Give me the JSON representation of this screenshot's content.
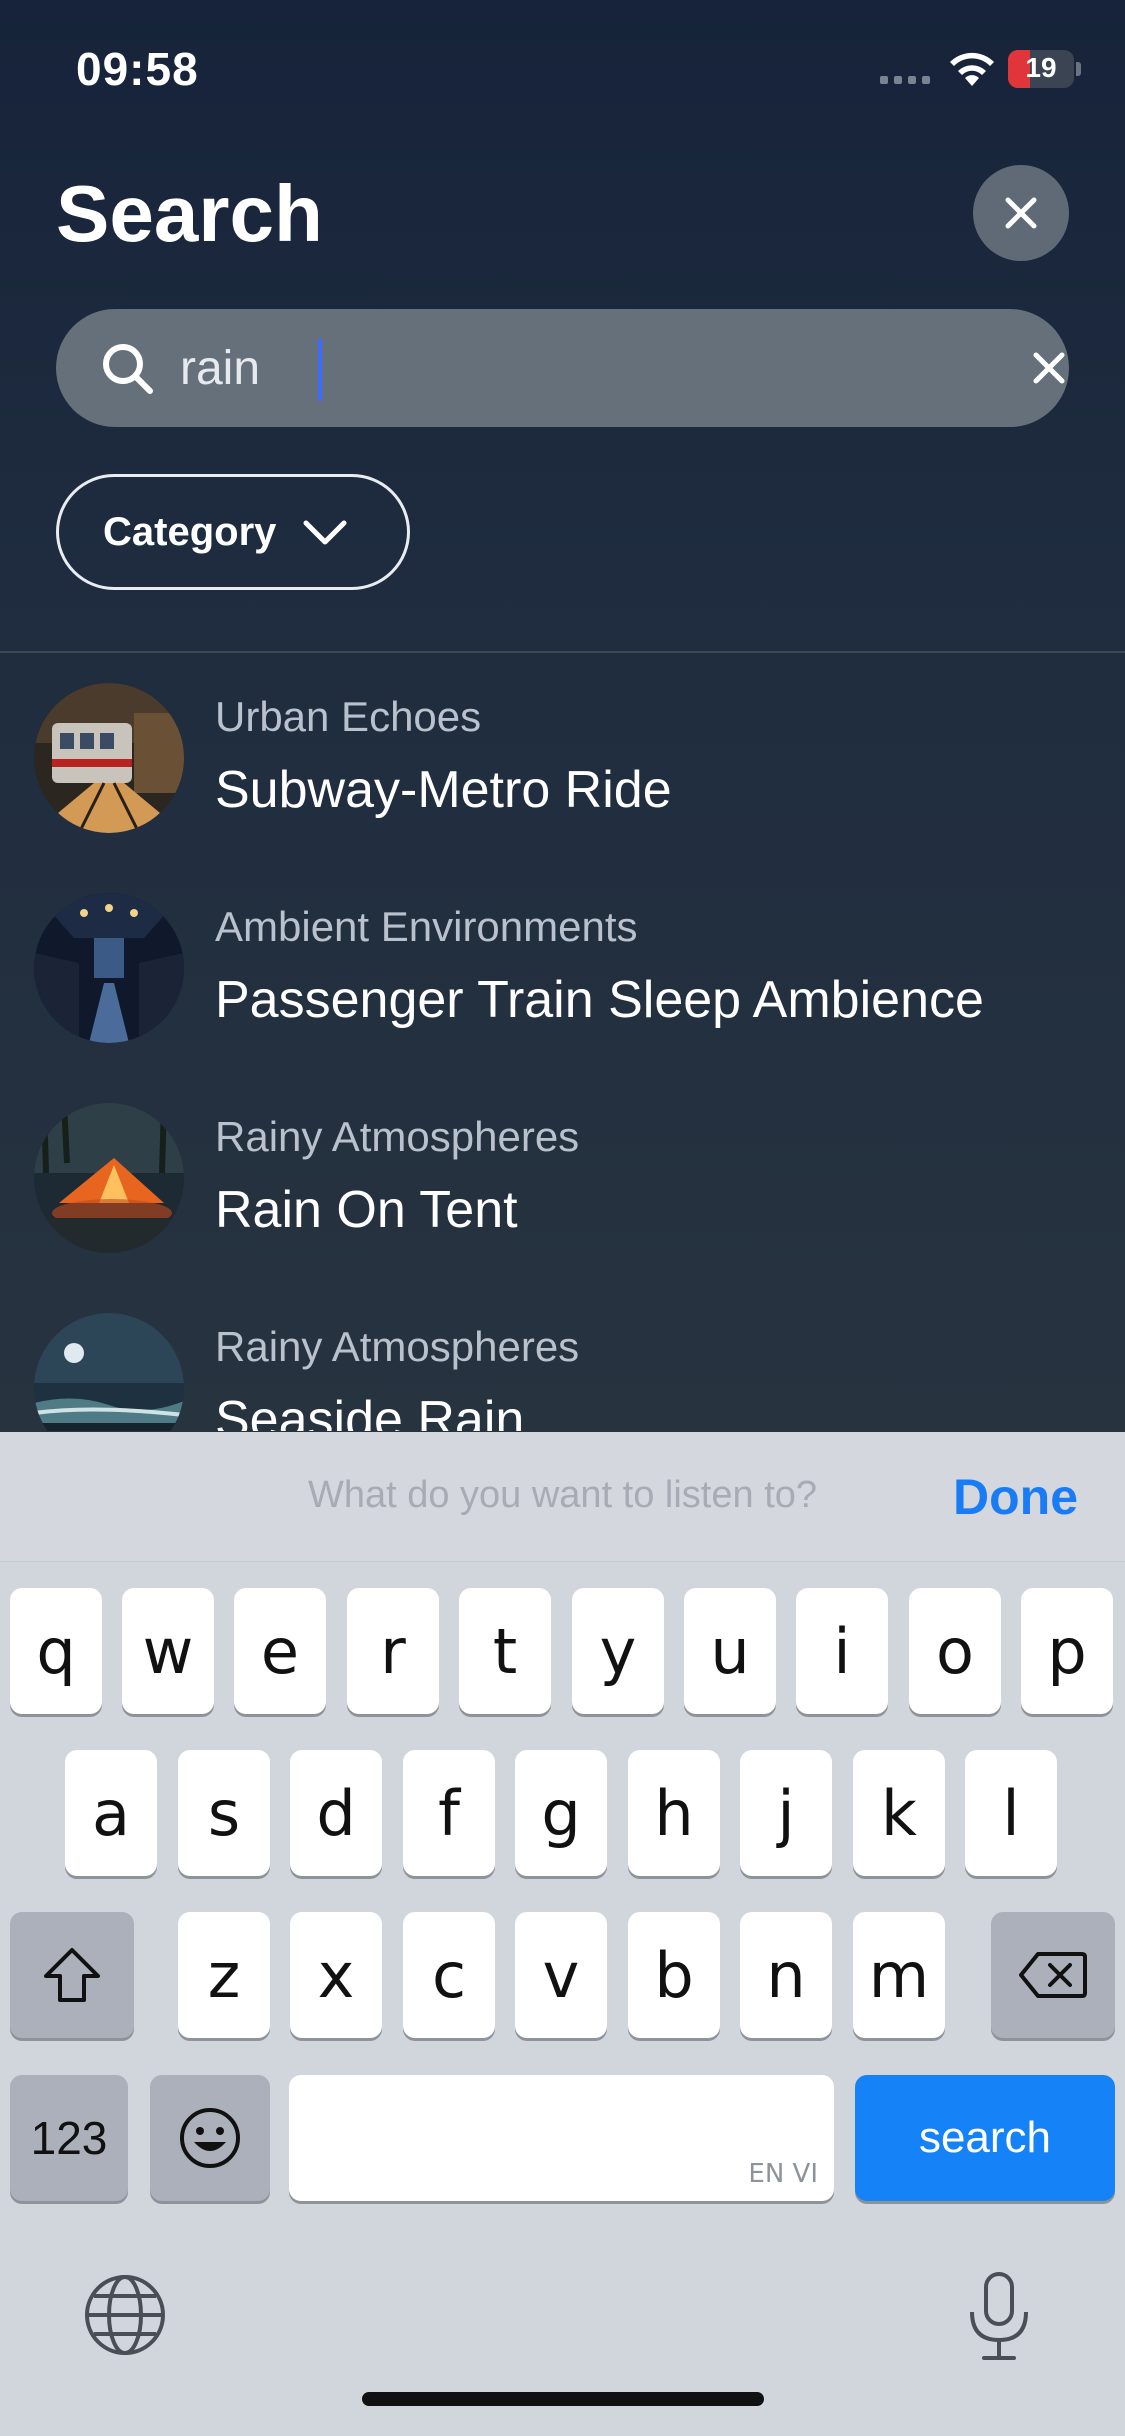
{
  "status_bar": {
    "time": "09:58",
    "battery": "19"
  },
  "header": {
    "title": "Search"
  },
  "search": {
    "value": "rain",
    "placeholder": "What do you want to listen to?"
  },
  "filter": {
    "category_label": "Category"
  },
  "results": [
    {
      "category": "Urban Echoes",
      "title": "Subway-Metro Ride"
    },
    {
      "category": "Ambient Environments",
      "title": "Passenger Train Sleep Ambience"
    },
    {
      "category": "Rainy Atmospheres",
      "title": "Rain On Tent"
    },
    {
      "category": "Rainy Atmospheres",
      "title": "Seaside Rain"
    }
  ],
  "keyboard": {
    "accessory_done": "Done",
    "row1": [
      "q",
      "w",
      "e",
      "r",
      "t",
      "y",
      "u",
      "i",
      "o",
      "p"
    ],
    "row2": [
      "a",
      "s",
      "d",
      "f",
      "g",
      "h",
      "j",
      "k",
      "l"
    ],
    "row3": [
      "z",
      "x",
      "c",
      "v",
      "b",
      "n",
      "m"
    ],
    "numbers_key": "123",
    "space_languages": "EN VI",
    "action_key": "search"
  },
  "colors": {
    "accent": "#1582f8",
    "done": "#1a7cf5",
    "battery_low": "#e0353a"
  }
}
